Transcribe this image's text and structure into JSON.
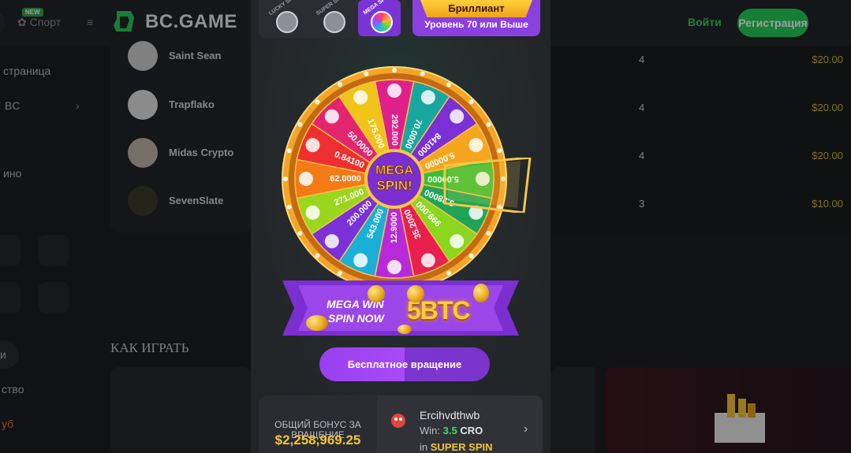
{
  "header": {
    "badge_new": "NEW",
    "sport_label": "Спорт",
    "brand": "BC.GAME",
    "login_label": "Войти",
    "register_label": "Регистрация"
  },
  "sidebar": {
    "items": [
      {
        "label": "страница"
      },
      {
        "label": "BC"
      },
      {
        "label": "ино"
      },
      {
        "label": "и"
      },
      {
        "label": "ство"
      },
      {
        "label": "уб"
      }
    ]
  },
  "winners": [
    {
      "name": "Saint Sean",
      "rank": "4",
      "amount": "$20.00"
    },
    {
      "name": "Trapflako",
      "rank": "4",
      "amount": "$20.00"
    },
    {
      "name": "Midas Crypto",
      "rank": "4",
      "amount": "$20.00"
    },
    {
      "name": "SevenSlate",
      "rank": "3",
      "amount": "$10.00"
    }
  ],
  "how_to_play": "КАК ИГРАТЬ",
  "modal": {
    "tiers": [
      {
        "label": "LUCKY SPIN!"
      },
      {
        "label": "SUPER SPIN!"
      },
      {
        "label": "MEGA SPIN!"
      }
    ],
    "level": {
      "title": "Бриллиант",
      "subtitle": "Уровень 70 или Выше"
    },
    "wheel": {
      "center_line1": "MEGA",
      "center_line2": "SPIN!",
      "segments": [
        {
          "value": "292.000",
          "color": "#e0208a"
        },
        {
          "value": "70.0000",
          "color": "#18a7a0"
        },
        {
          "value": "841000",
          "color": "#7a30d6"
        },
        {
          "value": "5.00000",
          "color": "#f5a51e"
        },
        {
          "value": "5.00000",
          "color": "#3cbf35"
        },
        {
          "value": "3.28000",
          "color": "#1fa55a"
        },
        {
          "value": "999.000",
          "color": "#8bd61e"
        },
        {
          "value": "35.2000",
          "color": "#e8204f"
        },
        {
          "value": "12.9000",
          "color": "#b62ad9"
        },
        {
          "value": "543.000",
          "color": "#1ab0d6"
        },
        {
          "value": "200.000",
          "color": "#7a32d8"
        },
        {
          "value": "271.000",
          "color": "#9bd61e"
        },
        {
          "value": "62.0000",
          "color": "#f47a16"
        },
        {
          "value": "0.84100",
          "color": "#ef2f2f"
        },
        {
          "value": "50.0000",
          "color": "#e3246e"
        },
        {
          "value": "175.000",
          "color": "#f0c419"
        }
      ]
    },
    "banner": {
      "line1": "MEGA WIN",
      "line2": "SPIN NOW",
      "prize": "5BTC"
    },
    "spin_button": "Бесплатное вращение",
    "bonus": {
      "label": "ОБЩИЙ БОНУС ЗА ВРАЩЕНИЕ",
      "value": "$2,258,969.25"
    },
    "last_win": {
      "name": "Ercihvdthwb",
      "win_prefix": "Win:",
      "amount": "3.5",
      "currency": "CRO",
      "in_prefix": "in",
      "game": "SUPER SPIN"
    }
  },
  "colors": {
    "accent_green": "#24ce5a",
    "accent_purple": "#9a3ff0",
    "gold": "#f3c436"
  }
}
